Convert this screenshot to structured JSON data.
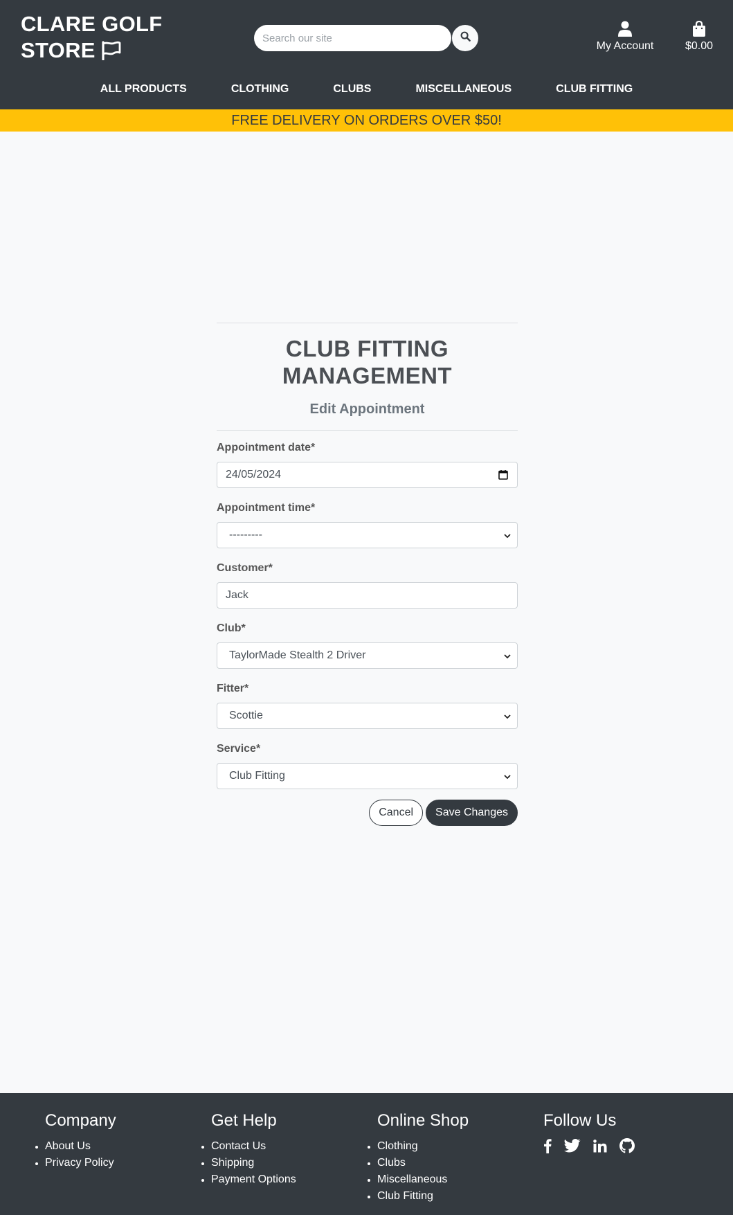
{
  "header": {
    "brand_line1": "CLARE GOLF",
    "brand_line2": "STORE",
    "search_placeholder": "Search our site",
    "account_label": "My Account",
    "cart_total": "$0.00"
  },
  "nav": {
    "items": [
      {
        "label": "ALL PRODUCTS"
      },
      {
        "label": "CLOTHING"
      },
      {
        "label": "CLUBS"
      },
      {
        "label": "MISCELLANEOUS"
      },
      {
        "label": "CLUB FITTING"
      }
    ]
  },
  "banner": {
    "text": "FREE DELIVERY ON ORDERS OVER $50!"
  },
  "main": {
    "title": "CLUB FITTING MANAGEMENT",
    "subtitle": "Edit Appointment",
    "fields": {
      "date": {
        "label": "Appointment date*",
        "value": "24/05/2024"
      },
      "time": {
        "label": "Appointment time*",
        "value": "---------"
      },
      "customer": {
        "label": "Customer*",
        "value": "Jack"
      },
      "club": {
        "label": "Club*",
        "value": "TaylorMade Stealth 2 Driver"
      },
      "fitter": {
        "label": "Fitter*",
        "value": "Scottie"
      },
      "service": {
        "label": "Service*",
        "value": "Club Fitting"
      }
    },
    "cancel_label": "Cancel",
    "save_label": "Save Changes"
  },
  "footer": {
    "company": {
      "title": "Company",
      "links": [
        "About Us",
        "Privacy Policy"
      ]
    },
    "help": {
      "title": "Get Help",
      "links": [
        "Contact Us",
        "Shipping",
        "Payment Options"
      ]
    },
    "shop": {
      "title": "Online Shop",
      "links": [
        "Clothing",
        "Clubs",
        "Miscellaneous",
        "Club Fitting"
      ]
    },
    "follow": {
      "title": "Follow Us",
      "icons": [
        "facebook-icon",
        "twitter-icon",
        "linkedin-icon",
        "github-icon"
      ]
    }
  },
  "colors": {
    "header_bg": "#343a40",
    "banner_bg": "#ffc107",
    "page_bg": "#f8f9fa"
  }
}
